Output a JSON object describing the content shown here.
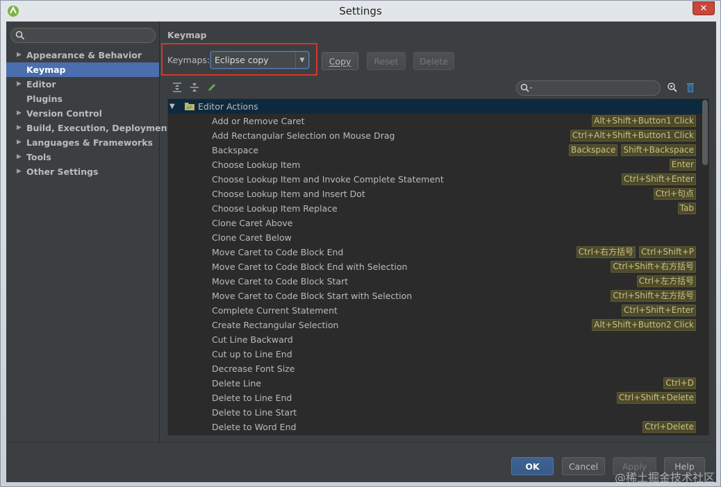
{
  "window": {
    "title": "Settings",
    "close_glyph": "✕"
  },
  "sidebar": {
    "search_placeholder": "",
    "items": [
      {
        "label": "Appearance & Behavior",
        "expandable": true
      },
      {
        "label": "Keymap",
        "expandable": false,
        "selected": true
      },
      {
        "label": "Editor",
        "expandable": true
      },
      {
        "label": "Plugins",
        "expandable": false
      },
      {
        "label": "Version Control",
        "expandable": true
      },
      {
        "label": "Build, Execution, Deployment",
        "expandable": true
      },
      {
        "label": "Languages & Frameworks",
        "expandable": true
      },
      {
        "label": "Tools",
        "expandable": true
      },
      {
        "label": "Other Settings",
        "expandable": true
      }
    ]
  },
  "main": {
    "section_title": "Keymap",
    "keymaps_label": "Keymaps:",
    "keymaps_value": "Eclipse copy",
    "copy_label": "Copy",
    "reset_label": "Reset",
    "delete_label": "Delete",
    "action_search_placeholder": ""
  },
  "actions": {
    "group_label": "Editor Actions",
    "rows": [
      {
        "label": "Add or Remove Caret",
        "shortcuts": [
          "Alt+Shift+Button1 Click"
        ]
      },
      {
        "label": "Add Rectangular Selection on Mouse Drag",
        "shortcuts": [
          "Ctrl+Alt+Shift+Button1 Click"
        ]
      },
      {
        "label": "Backspace",
        "shortcuts": [
          "Backspace",
          "Shift+Backspace"
        ]
      },
      {
        "label": "Choose Lookup Item",
        "shortcuts": [
          "Enter"
        ]
      },
      {
        "label": "Choose Lookup Item and Invoke Complete Statement",
        "shortcuts": [
          "Ctrl+Shift+Enter"
        ]
      },
      {
        "label": "Choose Lookup Item and Insert Dot",
        "shortcuts": [
          "Ctrl+句点"
        ]
      },
      {
        "label": "Choose Lookup Item Replace",
        "shortcuts": [
          "Tab"
        ]
      },
      {
        "label": "Clone Caret Above",
        "shortcuts": []
      },
      {
        "label": "Clone Caret Below",
        "shortcuts": []
      },
      {
        "label": "Move Caret to Code Block End",
        "shortcuts": [
          "Ctrl+右方括号",
          "Ctrl+Shift+P"
        ]
      },
      {
        "label": "Move Caret to Code Block End with Selection",
        "shortcuts": [
          "Ctrl+Shift+右方括号"
        ]
      },
      {
        "label": "Move Caret to Code Block Start",
        "shortcuts": [
          "Ctrl+左方括号"
        ]
      },
      {
        "label": "Move Caret to Code Block Start with Selection",
        "shortcuts": [
          "Ctrl+Shift+左方括号"
        ]
      },
      {
        "label": "Complete Current Statement",
        "shortcuts": [
          "Ctrl+Shift+Enter"
        ]
      },
      {
        "label": "Create Rectangular Selection",
        "shortcuts": [
          "Alt+Shift+Button2 Click"
        ]
      },
      {
        "label": "Cut Line Backward",
        "shortcuts": []
      },
      {
        "label": "Cut up to Line End",
        "shortcuts": []
      },
      {
        "label": "Decrease Font Size",
        "shortcuts": []
      },
      {
        "label": "Delete Line",
        "shortcuts": [
          "Ctrl+D"
        ]
      },
      {
        "label": "Delete to Line End",
        "shortcuts": [
          "Ctrl+Shift+Delete"
        ]
      },
      {
        "label": "Delete to Line Start",
        "shortcuts": []
      },
      {
        "label": "Delete to Word End",
        "shortcuts": [
          "Ctrl+Delete"
        ]
      }
    ]
  },
  "footer": {
    "ok_label": "OK",
    "cancel_label": "Cancel",
    "apply_label": "Apply",
    "help_label": "Help"
  },
  "watermark": "@稀土掘金技术社区",
  "colors": {
    "selection": "#4b6eaf",
    "highlight_box": "#d9342b",
    "shortcut_bg": "#4e4b2a"
  }
}
